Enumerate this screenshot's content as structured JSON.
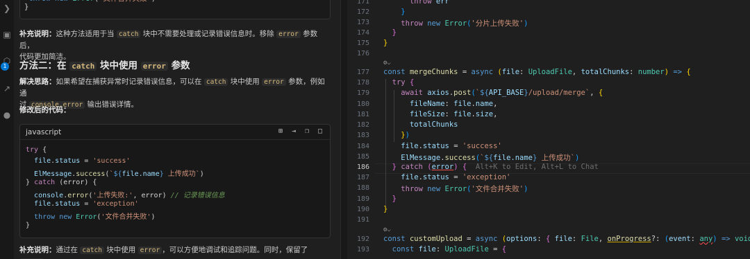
{
  "activity_bar": {
    "badge": "1"
  },
  "chat": {
    "top_code_line": "throw new Error('文件合并失败')",
    "top_code_close": "}",
    "note1": {
      "label": "补充说明：",
      "t1": "这种方法适用于当",
      "c1": "catch",
      "t2": "块中不需要处理或记录错误信息时。移除",
      "c2": "error",
      "t3": "参数后，",
      "t4": "代码更加简洁。"
    },
    "heading": {
      "t1": "方法二：在",
      "c1": "catch",
      "t2": "块中使用",
      "c2": "error",
      "t3": "参数"
    },
    "idea": {
      "label": "解决思路：",
      "t1": "如果希望在捕获异常时记录错误信息，可以在",
      "c1": "catch",
      "t2": "块中使用",
      "c2": "error",
      "t3": "参数，例如通",
      "t4": "过",
      "c3": "console.error",
      "t5": "输出错误详情。"
    },
    "modified_label": "修改后的代码：",
    "code_block": {
      "language": "javascript"
    },
    "note2": {
      "label": "补充说明：",
      "t1": "通过在",
      "c1": "catch",
      "t2": "块中使用",
      "c2": "error",
      "t3": "，可以方便地调试和追踪问题。同时，保留了",
      "c3": "error"
    }
  },
  "editor": {
    "line_numbers": [
      "171",
      "172",
      "173",
      "174",
      "175",
      "176",
      "177",
      "178",
      "179",
      "180",
      "181",
      "182",
      "183",
      "184",
      "185",
      "186",
      "187",
      "188",
      "189",
      "190",
      "191",
      "192",
      "193"
    ],
    "current_line": "186",
    "inline_hint": "Alt+K to Edit, Alt+L to Chat"
  }
}
